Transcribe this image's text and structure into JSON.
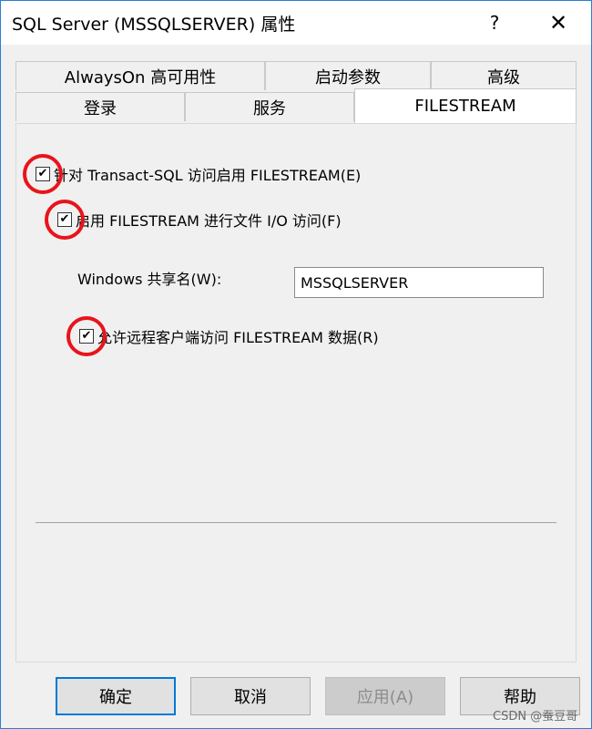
{
  "window": {
    "title": "SQL Server (MSSQLSERVER) 属性",
    "help_glyph": "?",
    "close_glyph": "✕"
  },
  "tabs": {
    "row1": [
      {
        "label": "AlwaysOn 高可用性"
      },
      {
        "label": "启动参数"
      },
      {
        "label": "高级"
      }
    ],
    "row2": [
      {
        "label": "登录"
      },
      {
        "label": "服务"
      },
      {
        "label": "FILESTREAM",
        "active": true
      }
    ]
  },
  "filestream": {
    "enable_tsql": {
      "label": "针对 Transact-SQL 访问启用 FILESTREAM(E)",
      "checked": true
    },
    "enable_io": {
      "label": "启用 FILESTREAM 进行文件 I/O 访问(F)",
      "checked": true
    },
    "share_name_label": "Windows 共享名(W):",
    "share_name_value": "MSSQLSERVER",
    "allow_remote": {
      "label": "允许远程客户端访问 FILESTREAM 数据(R)",
      "checked": true
    },
    "check_glyph": "✔"
  },
  "buttons": {
    "ok": "确定",
    "cancel": "取消",
    "apply": "应用(A)",
    "help": "帮助"
  },
  "watermark": "CSDN @蚕豆哥",
  "colors": {
    "highlight_ring": "#e8141b",
    "window_border": "#2a7fd4",
    "default_button_border": "#0078d7"
  }
}
